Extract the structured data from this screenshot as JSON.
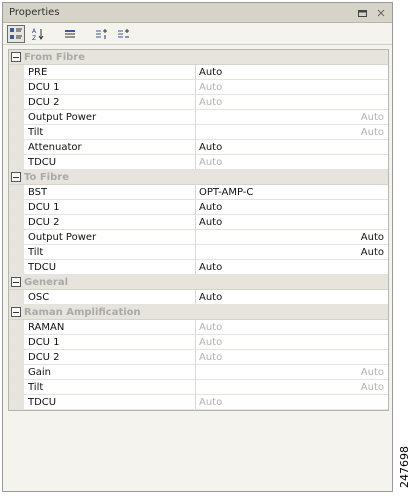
{
  "window": {
    "title": "Properties",
    "buttons": [
      "restore-icon",
      "close-icon"
    ]
  },
  "toolbar": {
    "items": [
      "categorized-icon",
      "alphabetical-icon",
      "property-pages-icon",
      "expand-icon",
      "collapse-icon"
    ]
  },
  "categories": [
    {
      "name": "From Fibre",
      "rows": [
        {
          "label": "PRE",
          "value": "Auto",
          "align": "left",
          "grey": false
        },
        {
          "label": "DCU 1",
          "value": "Auto",
          "align": "left",
          "grey": true
        },
        {
          "label": "DCU 2",
          "value": "Auto",
          "align": "left",
          "grey": true
        },
        {
          "label": "Output Power",
          "value": "Auto",
          "align": "right",
          "grey": true
        },
        {
          "label": "Tilt",
          "value": "Auto",
          "align": "right",
          "grey": true
        },
        {
          "label": "Attenuator",
          "value": "Auto",
          "align": "left",
          "grey": false
        },
        {
          "label": "TDCU",
          "value": "Auto",
          "align": "left",
          "grey": true
        }
      ]
    },
    {
      "name": "To Fibre",
      "rows": [
        {
          "label": "BST",
          "value": "OPT-AMP-C",
          "align": "left",
          "grey": false
        },
        {
          "label": "DCU 1",
          "value": "Auto",
          "align": "left",
          "grey": false
        },
        {
          "label": "DCU 2",
          "value": "Auto",
          "align": "left",
          "grey": false
        },
        {
          "label": "Output Power",
          "value": "Auto",
          "align": "right",
          "grey": false
        },
        {
          "label": "Tilt",
          "value": "Auto",
          "align": "right",
          "grey": false
        },
        {
          "label": "TDCU",
          "value": "Auto",
          "align": "left",
          "grey": false
        }
      ]
    },
    {
      "name": "General",
      "rows": [
        {
          "label": "OSC",
          "value": "Auto",
          "align": "left",
          "grey": false
        }
      ]
    },
    {
      "name": "Raman Amplification",
      "rows": [
        {
          "label": "RAMAN",
          "value": "Auto",
          "align": "left",
          "grey": true
        },
        {
          "label": "DCU 1",
          "value": "Auto",
          "align": "left",
          "grey": true
        },
        {
          "label": "DCU 2",
          "value": "Auto",
          "align": "left",
          "grey": true
        },
        {
          "label": "Gain",
          "value": "Auto",
          "align": "right",
          "grey": true
        },
        {
          "label": "Tilt",
          "value": "Auto",
          "align": "right",
          "grey": true
        },
        {
          "label": "TDCU",
          "value": "Auto",
          "align": "left",
          "grey": true
        }
      ]
    }
  ],
  "figure_id": "247698",
  "colors": {
    "titlebar": "#d6d3c8",
    "category_bg": "#e6e4dc",
    "disabled_text": "#b2b2b2"
  }
}
